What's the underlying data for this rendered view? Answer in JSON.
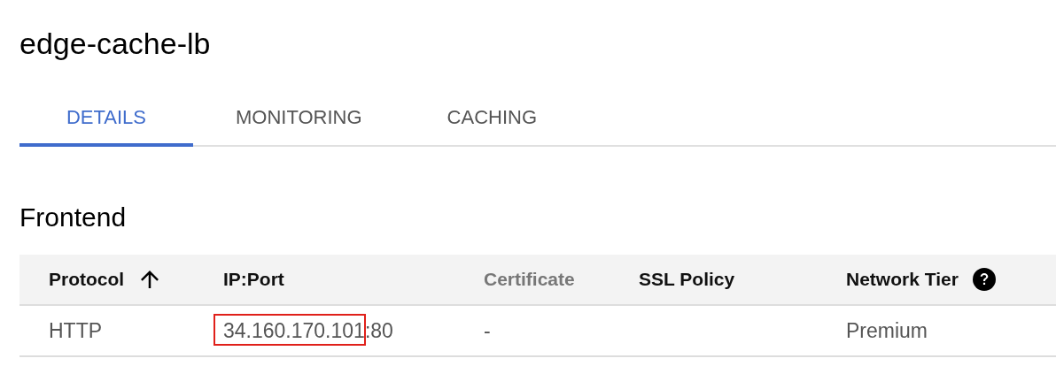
{
  "title": "edge-cache-lb",
  "tabs": [
    {
      "label": "DETAILS",
      "selected": true
    },
    {
      "label": "MONITORING",
      "selected": false
    },
    {
      "label": "CACHING",
      "selected": false
    }
  ],
  "section": {
    "title": "Frontend"
  },
  "table": {
    "columns": [
      {
        "label": "Protocol",
        "disabled": false,
        "sorted": true,
        "help": false
      },
      {
        "label": "IP:Port",
        "disabled": false,
        "sorted": false,
        "help": false
      },
      {
        "label": "Certificate",
        "disabled": true,
        "sorted": false,
        "help": false
      },
      {
        "label": "SSL Policy",
        "disabled": false,
        "sorted": false,
        "help": false
      },
      {
        "label": "Network Tier",
        "disabled": false,
        "sorted": false,
        "help": true
      }
    ],
    "rows": [
      {
        "cells": [
          {
            "text": "HTTP",
            "highlighted": false
          },
          {
            "text": "34.160.170.101:80",
            "highlighted": true
          },
          {
            "text": "-",
            "highlighted": false
          },
          {
            "text": "",
            "highlighted": false
          },
          {
            "text": "Premium",
            "highlighted": false
          }
        ]
      }
    ]
  }
}
